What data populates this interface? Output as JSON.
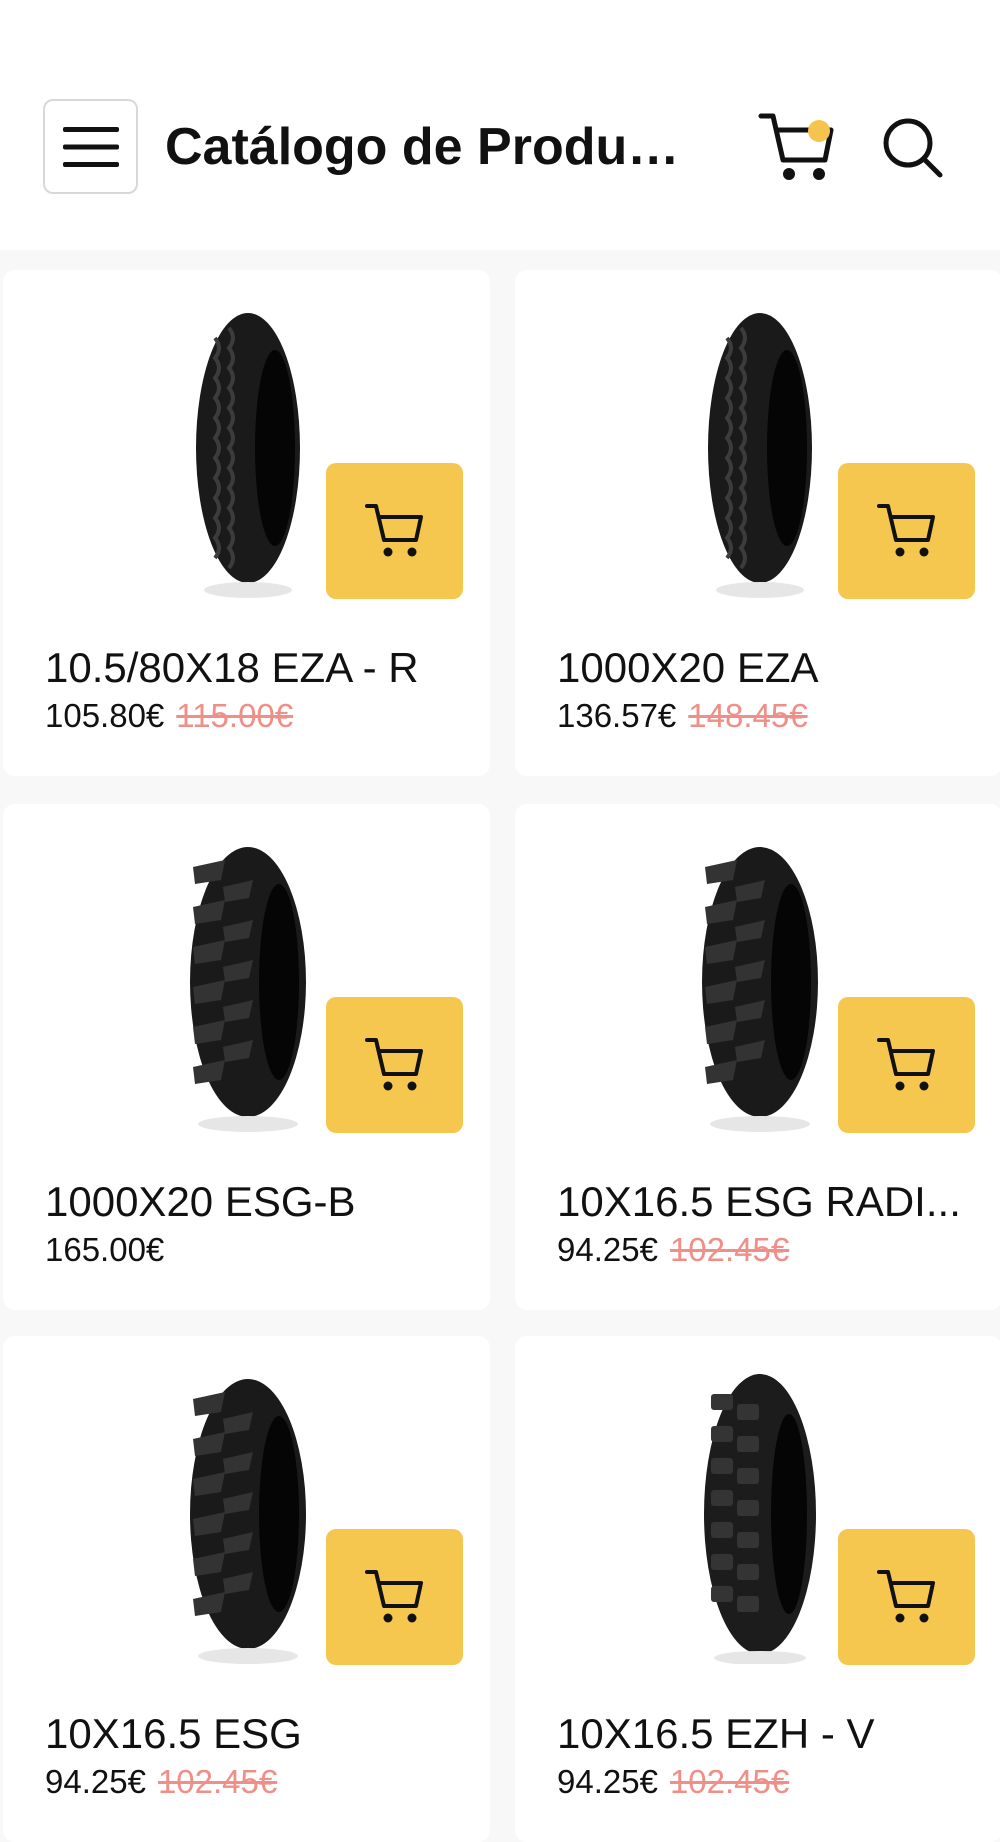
{
  "header": {
    "title": "Catálogo de Produt...",
    "cart_badge_color": "#f5c44e"
  },
  "products": [
    {
      "name": "10.5/80X18 EZA - R",
      "price": "105.80€",
      "old_price": "115.00€",
      "tread": "rib"
    },
    {
      "name": "1000X20 EZA",
      "price": "136.57€",
      "old_price": "148.45€",
      "tread": "rib"
    },
    {
      "name": "1000X20 ESG-B",
      "price": "165.00€",
      "old_price": "",
      "tread": "lug"
    },
    {
      "name": "10X16.5 ESG RADI...",
      "price": "94.25€",
      "old_price": "102.45€",
      "tread": "lug"
    },
    {
      "name": "10X16.5 ESG",
      "price": "94.25€",
      "old_price": "102.45€",
      "tread": "lug"
    },
    {
      "name": "10X16.5 EZH - V",
      "price": "94.25€",
      "old_price": "102.45€",
      "tread": "block"
    }
  ],
  "colors": {
    "accent": "#f5c74f",
    "old_price": "#ee8f88",
    "background": "#f8f8f8"
  }
}
